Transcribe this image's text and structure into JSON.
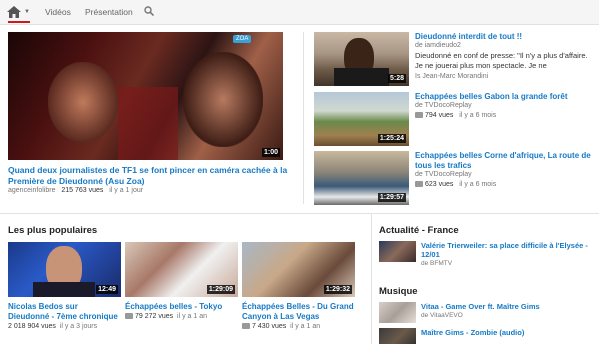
{
  "nav": {
    "tabs": [
      "Vidéos",
      "Présentation"
    ],
    "home_icon": "home-icon",
    "search_icon": "search-icon",
    "accent": "#cc181e"
  },
  "featured": {
    "title": "Quand deux journalistes de TF1 se font pincer en caméra cachée à la Première de Dieudonné (Asu Zoa)",
    "channel": "agenceinfolibre",
    "views": "215 763 vues",
    "age": "il y a 1 jour",
    "duration": "1:00",
    "logo_text": "ZOA"
  },
  "side": [
    {
      "title": "Dieudonné interdit de tout !!",
      "by": "de iamdieudo2",
      "desc": "Dieudonné en conf de presse: \"Il n'y a plus d'affaire. Je ne jouerai plus mon spectacle. Je ne",
      "foot": "Is Jean-Marc Morandini",
      "duration": "5:28"
    },
    {
      "title": "Echappées belles Gabon la grande forêt",
      "by": "de TVDocoReplay",
      "views": "794 vues",
      "age": "il y a 6 mois",
      "duration": "1:25:24"
    },
    {
      "title": "Echappées belles Corne d'afrique, La route de tous les trafics",
      "by": "de TVDocoReplay",
      "views": "623 vues",
      "age": "il y a 6 mois",
      "duration": "1:29:57"
    }
  ],
  "popular": {
    "heading": "Les plus populaires",
    "items": [
      {
        "title": "Nicolas Bedos sur Dieudonné - 7ème chronique",
        "views": "2 018 904 vues",
        "age": "il y a 3 jours",
        "duration": "12:49"
      },
      {
        "title": "Échappées belles - Tokyo",
        "views": "79 272 vues",
        "age": "il y a 1 an",
        "duration": "1:29:09"
      },
      {
        "title": "Échappées Belles - Du Grand Canyon à Las Vegas",
        "views": "7 430 vues",
        "age": "il y a 1 an",
        "duration": "1:29:32"
      }
    ]
  },
  "actualite": {
    "heading": "Actualité - France",
    "items": [
      {
        "title": "Valérie Trierweiler: sa place difficile à l'Elysée - 12/01",
        "by": "de BFMTV"
      }
    ]
  },
  "musique": {
    "heading": "Musique",
    "items": [
      {
        "title": "Vitaa - Game Over ft. Maître Gims",
        "by": "de VitaaVEVO"
      },
      {
        "title": "Maître Gims - Zombie (audio)",
        "by": ""
      }
    ]
  }
}
